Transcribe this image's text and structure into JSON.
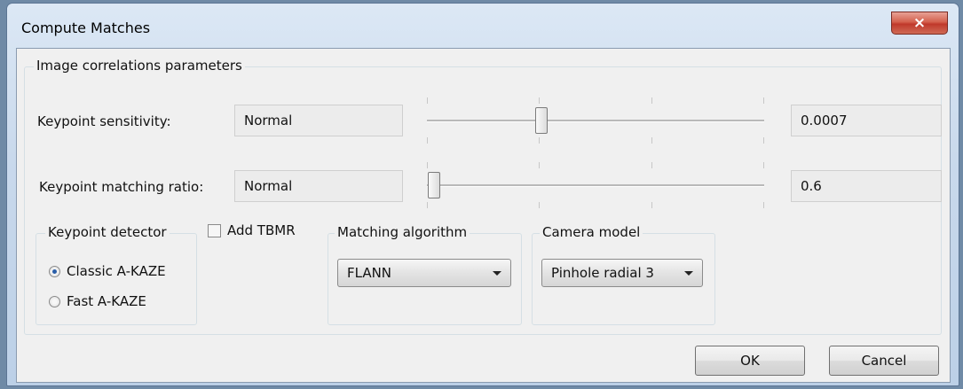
{
  "window": {
    "title": "Compute Matches",
    "close_icon": "×"
  },
  "params_group": {
    "legend": "Image correlations parameters",
    "sensitivity": {
      "label": "Keypoint sensitivity:",
      "preset": "Normal",
      "value": "0.0007",
      "slider_fraction": 0.34
    },
    "matching_ratio": {
      "label": "Keypoint matching ratio:",
      "preset": "Normal",
      "value": "0.6",
      "slider_fraction": 0.02
    }
  },
  "detector_group": {
    "legend": "Keypoint detector",
    "options": [
      "Classic A-KAZE",
      "Fast A-KAZE"
    ],
    "selected": "Classic A-KAZE"
  },
  "add_tbmr": {
    "label": "Add TBMR",
    "checked": false
  },
  "matching_group": {
    "legend": "Matching algorithm",
    "selected": "FLANN"
  },
  "camera_group": {
    "legend": "Camera model",
    "selected": "Pinhole radial 3"
  },
  "buttons": {
    "ok": "OK",
    "cancel": "Cancel"
  }
}
